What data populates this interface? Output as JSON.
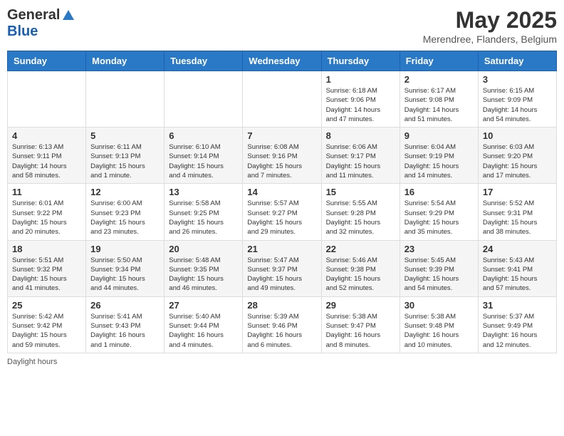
{
  "header": {
    "logo_general": "General",
    "logo_blue": "Blue",
    "month_title": "May 2025",
    "location": "Merendree, Flanders, Belgium"
  },
  "days_of_week": [
    "Sunday",
    "Monday",
    "Tuesday",
    "Wednesday",
    "Thursday",
    "Friday",
    "Saturday"
  ],
  "weeks": [
    [
      {
        "day": "",
        "info": ""
      },
      {
        "day": "",
        "info": ""
      },
      {
        "day": "",
        "info": ""
      },
      {
        "day": "",
        "info": ""
      },
      {
        "day": "1",
        "info": "Sunrise: 6:18 AM\nSunset: 9:06 PM\nDaylight: 14 hours\nand 47 minutes."
      },
      {
        "day": "2",
        "info": "Sunrise: 6:17 AM\nSunset: 9:08 PM\nDaylight: 14 hours\nand 51 minutes."
      },
      {
        "day": "3",
        "info": "Sunrise: 6:15 AM\nSunset: 9:09 PM\nDaylight: 14 hours\nand 54 minutes."
      }
    ],
    [
      {
        "day": "4",
        "info": "Sunrise: 6:13 AM\nSunset: 9:11 PM\nDaylight: 14 hours\nand 58 minutes."
      },
      {
        "day": "5",
        "info": "Sunrise: 6:11 AM\nSunset: 9:13 PM\nDaylight: 15 hours\nand 1 minute."
      },
      {
        "day": "6",
        "info": "Sunrise: 6:10 AM\nSunset: 9:14 PM\nDaylight: 15 hours\nand 4 minutes."
      },
      {
        "day": "7",
        "info": "Sunrise: 6:08 AM\nSunset: 9:16 PM\nDaylight: 15 hours\nand 7 minutes."
      },
      {
        "day": "8",
        "info": "Sunrise: 6:06 AM\nSunset: 9:17 PM\nDaylight: 15 hours\nand 11 minutes."
      },
      {
        "day": "9",
        "info": "Sunrise: 6:04 AM\nSunset: 9:19 PM\nDaylight: 15 hours\nand 14 minutes."
      },
      {
        "day": "10",
        "info": "Sunrise: 6:03 AM\nSunset: 9:20 PM\nDaylight: 15 hours\nand 17 minutes."
      }
    ],
    [
      {
        "day": "11",
        "info": "Sunrise: 6:01 AM\nSunset: 9:22 PM\nDaylight: 15 hours\nand 20 minutes."
      },
      {
        "day": "12",
        "info": "Sunrise: 6:00 AM\nSunset: 9:23 PM\nDaylight: 15 hours\nand 23 minutes."
      },
      {
        "day": "13",
        "info": "Sunrise: 5:58 AM\nSunset: 9:25 PM\nDaylight: 15 hours\nand 26 minutes."
      },
      {
        "day": "14",
        "info": "Sunrise: 5:57 AM\nSunset: 9:27 PM\nDaylight: 15 hours\nand 29 minutes."
      },
      {
        "day": "15",
        "info": "Sunrise: 5:55 AM\nSunset: 9:28 PM\nDaylight: 15 hours\nand 32 minutes."
      },
      {
        "day": "16",
        "info": "Sunrise: 5:54 AM\nSunset: 9:29 PM\nDaylight: 15 hours\nand 35 minutes."
      },
      {
        "day": "17",
        "info": "Sunrise: 5:52 AM\nSunset: 9:31 PM\nDaylight: 15 hours\nand 38 minutes."
      }
    ],
    [
      {
        "day": "18",
        "info": "Sunrise: 5:51 AM\nSunset: 9:32 PM\nDaylight: 15 hours\nand 41 minutes."
      },
      {
        "day": "19",
        "info": "Sunrise: 5:50 AM\nSunset: 9:34 PM\nDaylight: 15 hours\nand 44 minutes."
      },
      {
        "day": "20",
        "info": "Sunrise: 5:48 AM\nSunset: 9:35 PM\nDaylight: 15 hours\nand 46 minutes."
      },
      {
        "day": "21",
        "info": "Sunrise: 5:47 AM\nSunset: 9:37 PM\nDaylight: 15 hours\nand 49 minutes."
      },
      {
        "day": "22",
        "info": "Sunrise: 5:46 AM\nSunset: 9:38 PM\nDaylight: 15 hours\nand 52 minutes."
      },
      {
        "day": "23",
        "info": "Sunrise: 5:45 AM\nSunset: 9:39 PM\nDaylight: 15 hours\nand 54 minutes."
      },
      {
        "day": "24",
        "info": "Sunrise: 5:43 AM\nSunset: 9:41 PM\nDaylight: 15 hours\nand 57 minutes."
      }
    ],
    [
      {
        "day": "25",
        "info": "Sunrise: 5:42 AM\nSunset: 9:42 PM\nDaylight: 15 hours\nand 59 minutes."
      },
      {
        "day": "26",
        "info": "Sunrise: 5:41 AM\nSunset: 9:43 PM\nDaylight: 16 hours\nand 1 minute."
      },
      {
        "day": "27",
        "info": "Sunrise: 5:40 AM\nSunset: 9:44 PM\nDaylight: 16 hours\nand 4 minutes."
      },
      {
        "day": "28",
        "info": "Sunrise: 5:39 AM\nSunset: 9:46 PM\nDaylight: 16 hours\nand 6 minutes."
      },
      {
        "day": "29",
        "info": "Sunrise: 5:38 AM\nSunset: 9:47 PM\nDaylight: 16 hours\nand 8 minutes."
      },
      {
        "day": "30",
        "info": "Sunrise: 5:38 AM\nSunset: 9:48 PM\nDaylight: 16 hours\nand 10 minutes."
      },
      {
        "day": "31",
        "info": "Sunrise: 5:37 AM\nSunset: 9:49 PM\nDaylight: 16 hours\nand 12 minutes."
      }
    ]
  ],
  "footer": {
    "daylight_label": "Daylight hours"
  }
}
